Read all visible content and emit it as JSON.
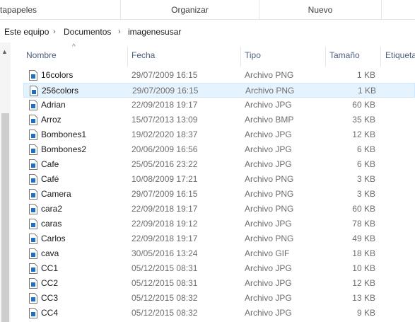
{
  "ribbon": {
    "groups": [
      "tapapeles",
      "Organizar",
      "Nuevo"
    ]
  },
  "breadcrumb": {
    "items": [
      "Este equipo",
      "Documentos",
      "imagenesusar"
    ],
    "separator": "›"
  },
  "columns": {
    "name": "Nombre",
    "date": "Fecha",
    "type": "Tipo",
    "size": "Tamaño",
    "tags": "Etiqueta"
  },
  "files": [
    {
      "name": "16colors",
      "date": "29/07/2009 16:15",
      "type": "Archivo PNG",
      "size": "1 KB"
    },
    {
      "name": "256colors",
      "date": "29/07/2009 16:15",
      "type": "Archivo PNG",
      "size": "1 KB",
      "selected": true
    },
    {
      "name": "Adrian",
      "date": "22/09/2018 19:17",
      "type": "Archivo JPG",
      "size": "60 KB"
    },
    {
      "name": "Arroz",
      "date": "15/07/2013 13:09",
      "type": "Archivo BMP",
      "size": "35 KB"
    },
    {
      "name": "Bombones1",
      "date": "19/02/2020 18:37",
      "type": "Archivo JPG",
      "size": "12 KB"
    },
    {
      "name": "Bombones2",
      "date": "20/06/2009 16:56",
      "type": "Archivo JPG",
      "size": "6 KB"
    },
    {
      "name": "Cafe",
      "date": "25/05/2016 23:22",
      "type": "Archivo JPG",
      "size": "6 KB"
    },
    {
      "name": "Café",
      "date": "10/08/2009 17:21",
      "type": "Archivo PNG",
      "size": "3 KB"
    },
    {
      "name": "Camera",
      "date": "29/07/2009 16:15",
      "type": "Archivo PNG",
      "size": "3 KB"
    },
    {
      "name": "cara2",
      "date": "22/09/2018 19:17",
      "type": "Archivo PNG",
      "size": "60 KB"
    },
    {
      "name": "caras",
      "date": "22/09/2018 19:12",
      "type": "Archivo JPG",
      "size": "78 KB"
    },
    {
      "name": "Carlos",
      "date": "22/09/2018 19:17",
      "type": "Archivo PNG",
      "size": "49 KB"
    },
    {
      "name": "cava",
      "date": "30/05/2016 13:24",
      "type": "Archivo GIF",
      "size": "18 KB"
    },
    {
      "name": "CC1",
      "date": "05/12/2015 08:31",
      "type": "Archivo JPG",
      "size": "10 KB"
    },
    {
      "name": "CC2",
      "date": "05/12/2015 08:31",
      "type": "Archivo JPG",
      "size": "12 KB"
    },
    {
      "name": "CC3",
      "date": "05/12/2015 08:32",
      "type": "Archivo JPG",
      "size": "13 KB"
    },
    {
      "name": "CC4",
      "date": "05/12/2015 08:32",
      "type": "Archivo JPG",
      "size": "9 KB"
    }
  ],
  "icons": {
    "file": "image-file-icon",
    "sort": "sort-ascending-icon",
    "scroll": "scroll-up-icon"
  },
  "colors": {
    "selection_bg": "#e5f3ff",
    "selection_border": "#cce8ff",
    "header_text": "#4c607a",
    "icon_accent": "#1f6fc6"
  }
}
